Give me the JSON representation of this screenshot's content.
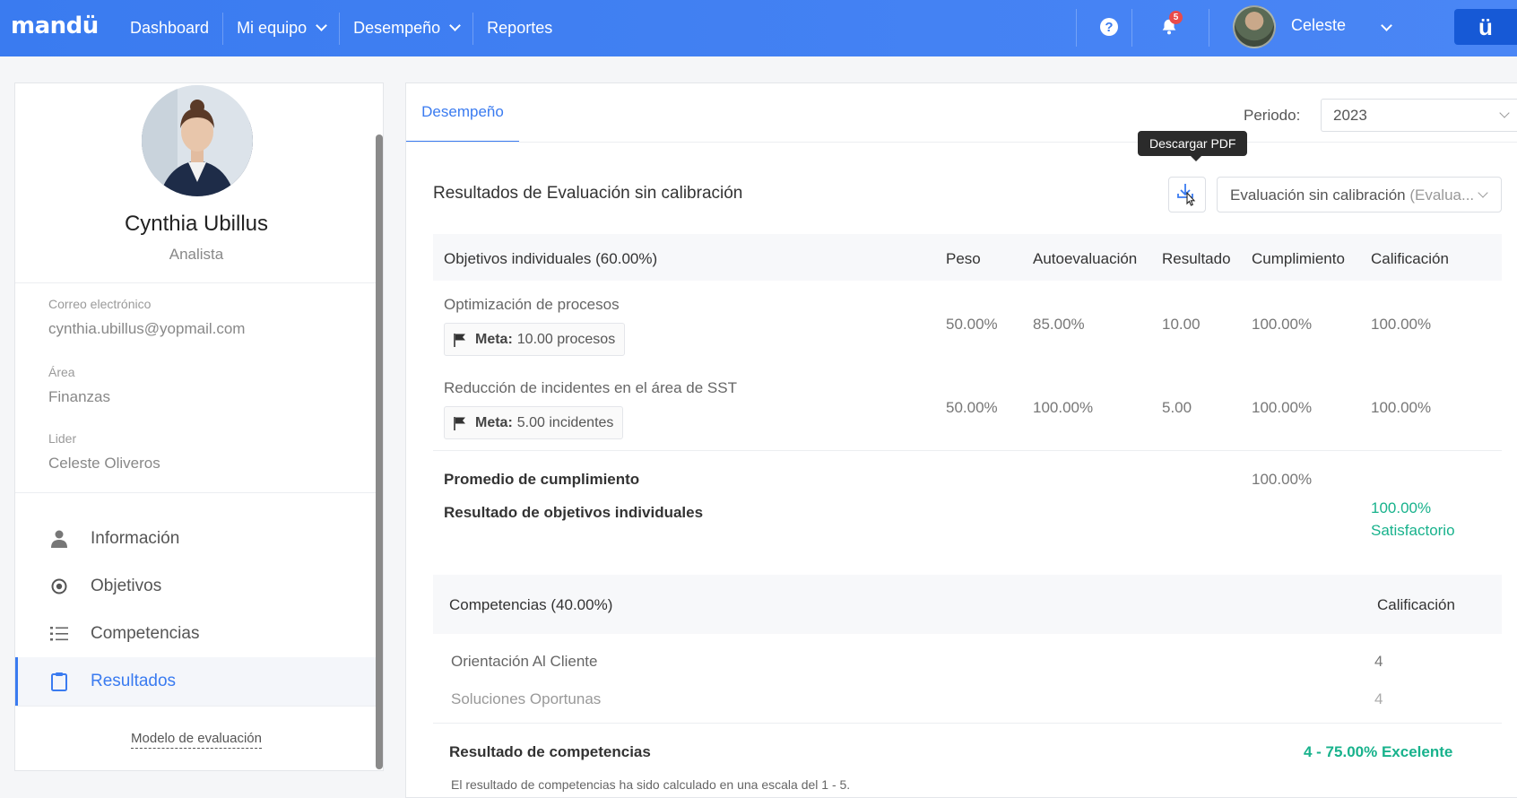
{
  "app": {
    "logo": "mandü",
    "brand_letter": "ü"
  },
  "nav": {
    "dashboard": "Dashboard",
    "mi_equipo": "Mi equipo",
    "desempeno": "Desempeño",
    "reportes": "Reportes"
  },
  "topbar": {
    "help_glyph": "?",
    "notifications_count": "5",
    "user_name": "Celeste"
  },
  "profile": {
    "name": "Cynthia Ubillus",
    "role": "Analista",
    "email_label": "Correo electrónico",
    "email": "cynthia.ubillus@yopmail.com",
    "area_label": "Área",
    "area": "Finanzas",
    "leader_label": "Lider",
    "leader": "Celeste Oliveros"
  },
  "sidebar": {
    "items": [
      {
        "label": "Información",
        "icon": "user-icon"
      },
      {
        "label": "Objetivos",
        "icon": "target-icon"
      },
      {
        "label": "Competencias",
        "icon": "list-icon"
      },
      {
        "label": "Resultados",
        "icon": "clipboard-icon",
        "active": true
      }
    ],
    "model_link": "Modelo de evaluación"
  },
  "main": {
    "tab": "Desempeño",
    "period_label": "Periodo:",
    "period_value": "2023",
    "tooltip": "Descargar PDF",
    "section_title": "Resultados de Evaluación sin calibración",
    "eval_select_main": "Evaluación sin calibración",
    "eval_select_muted": " (Evalua..."
  },
  "objectives_table": {
    "headers": {
      "title": "Objetivos individuales (60.00%)",
      "peso": "Peso",
      "auto": "Autoevaluación",
      "resultado": "Resultado",
      "cumplimiento": "Cumplimiento",
      "calificacion": "Calificación"
    },
    "rows": [
      {
        "name": "Optimización de procesos",
        "meta_label": "Meta:",
        "meta_value": "10.00 procesos",
        "peso": "50.00%",
        "auto": "85.00%",
        "resultado": "10.00",
        "cumplimiento": "100.00%",
        "calificacion": "100.00%"
      },
      {
        "name": "Reducción de incidentes en el área de SST",
        "meta_label": "Meta:",
        "meta_value": "5.00 incidentes",
        "peso": "50.00%",
        "auto": "100.00%",
        "resultado": "5.00",
        "cumplimiento": "100.00%",
        "calificacion": "100.00%"
      }
    ],
    "promedio_label": "Promedio de cumplimiento",
    "promedio_value": "100.00%",
    "resultado_label": "Resultado de objetivos individuales",
    "resultado_value": "100.00%",
    "resultado_text": "Satisfactorio"
  },
  "competencies": {
    "header": "Competencias (40.00%)",
    "calificacion": "Calificación",
    "rows": [
      {
        "name": "Orientación Al Cliente",
        "value": "4"
      },
      {
        "name": "Soluciones Oportunas",
        "value": "4"
      }
    ],
    "result_label": "Resultado de competencias",
    "result_value": "4 - 75.00% Excelente",
    "note": "El resultado de competencias ha sido calculado en una escala del 1 - 5."
  },
  "colors": {
    "accent": "#3a7bf0",
    "green": "#18b28c",
    "badge": "#e94b4b"
  }
}
